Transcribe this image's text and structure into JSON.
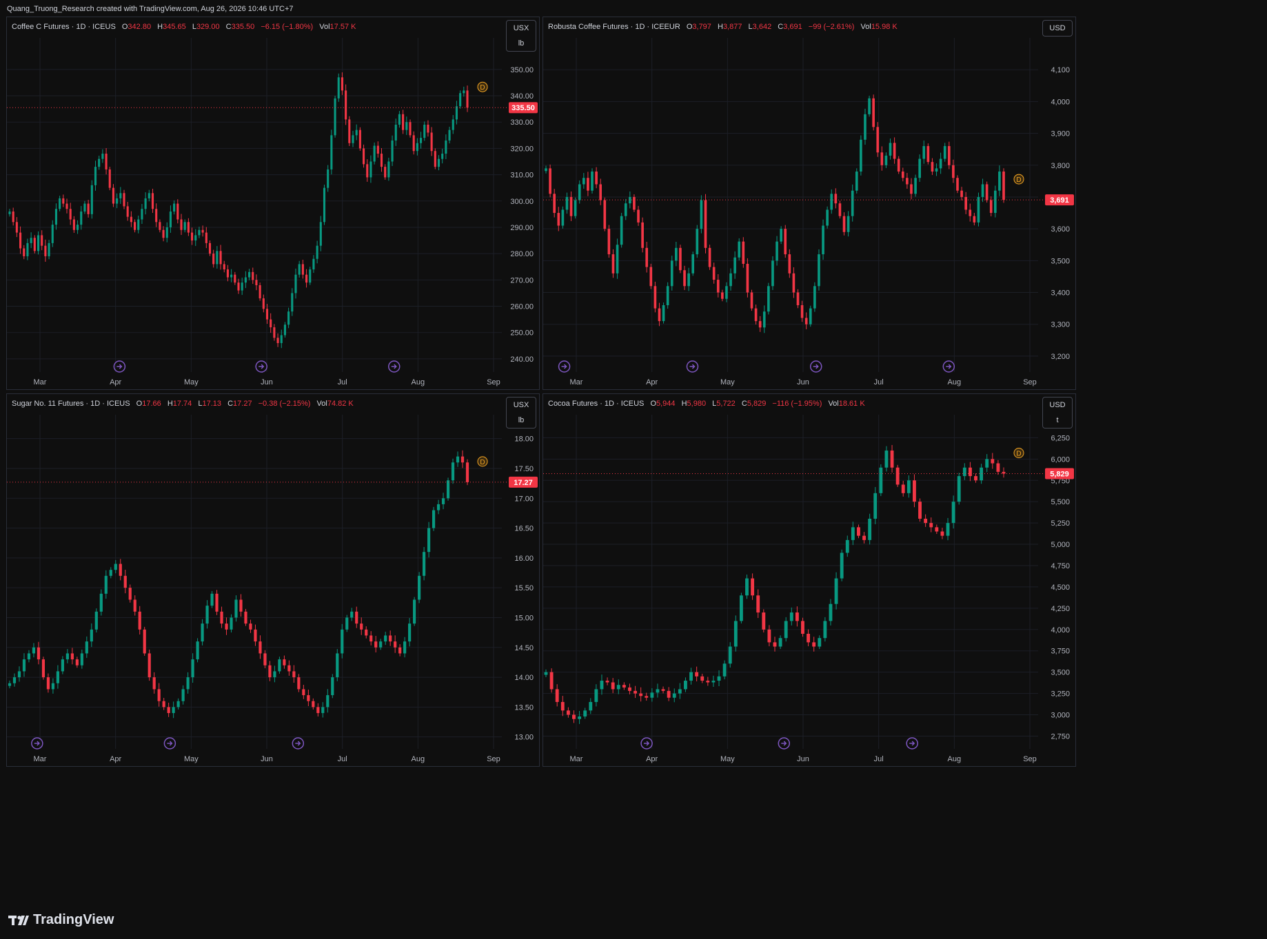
{
  "header": {
    "text": "Quang_Truong_Research created with TradingView.com, Aug 26, 2026 10:46 UTC+7"
  },
  "footer": {
    "brand": "TradingView"
  },
  "colors": {
    "up": "#089981",
    "down": "#f23645",
    "grid": "#1c1f27",
    "text": "#b2b5be",
    "marker": "#f5a623",
    "event": "#7e57c2"
  },
  "chart_data": [
    {
      "type": "candlestick",
      "legend": {
        "symbol": "Coffee C Futures · 1D · ICEUS",
        "open": "342.80",
        "high": "345.65",
        "low": "329.00",
        "close": "335.50",
        "change": "−6.15 (−1.80%)",
        "volume": "17.57 K"
      },
      "units": [
        "USX",
        "lb"
      ],
      "y_ticks": [
        "350.00",
        "340.00",
        "330.00",
        "320.00",
        "310.00",
        "300.00",
        "290.00",
        "280.00",
        "270.00",
        "260.00",
        "250.00",
        "240.00"
      ],
      "y_tick_values": [
        350,
        340,
        330,
        320,
        310,
        300,
        290,
        280,
        270,
        260,
        250,
        240
      ],
      "ylim": [
        235,
        362
      ],
      "x_ticks": [
        "Mar",
        "Apr",
        "May",
        "Jun",
        "Jul",
        "Aug",
        "Sep"
      ],
      "last_price": "335.50",
      "last_value": 335.5,
      "series": [
        296,
        292,
        288,
        282,
        279,
        284,
        286,
        281,
        287,
        283,
        279,
        284,
        291,
        297,
        301,
        299,
        297,
        293,
        289,
        291,
        296,
        299,
        295,
        306,
        313,
        316,
        318,
        312,
        305,
        299,
        301,
        303,
        298,
        294,
        292,
        289,
        293,
        297,
        301,
        303,
        297,
        292,
        289,
        286,
        290,
        296,
        299,
        293,
        289,
        292,
        288,
        285,
        287,
        289,
        288,
        284,
        280,
        276,
        281,
        276,
        274,
        271,
        272,
        269,
        266,
        269,
        271,
        273,
        270,
        268,
        263,
        259,
        255,
        252,
        248,
        246,
        249,
        253,
        258,
        265,
        272,
        276,
        272,
        269,
        274,
        278,
        283,
        292,
        305,
        312,
        325,
        339,
        347,
        342,
        331,
        322,
        325,
        327,
        320,
        314,
        309,
        315,
        321,
        318,
        313,
        309,
        315,
        323,
        329,
        333,
        327,
        330,
        325,
        319,
        322,
        324,
        329,
        326,
        319,
        313,
        316,
        318,
        323,
        327,
        331,
        336,
        341,
        342,
        335.5
      ],
      "event_positions": [
        0.24,
        0.55,
        0.84
      ]
    },
    {
      "type": "candlestick",
      "legend": {
        "symbol": "Robusta Coffee Futures · 1D · ICEEUR",
        "open": "3,797",
        "high": "3,877",
        "low": "3,642",
        "close": "3,691",
        "change": "−99 (−2.61%)",
        "volume": "15.98 K"
      },
      "units": [
        "USD"
      ],
      "y_ticks": [
        "4,100",
        "4,000",
        "3,900",
        "3,800",
        "3,700",
        "3,600",
        "3,500",
        "3,400",
        "3,300",
        "3,200"
      ],
      "y_tick_values": [
        4100,
        4000,
        3900,
        3800,
        3700,
        3600,
        3500,
        3400,
        3300,
        3200
      ],
      "ylim": [
        3150,
        4200
      ],
      "x_ticks": [
        "Mar",
        "Apr",
        "May",
        "Jun",
        "Jul",
        "Aug",
        "Sep"
      ],
      "last_price": "3,691",
      "last_value": 3691,
      "series": [
        3790,
        3710,
        3650,
        3610,
        3660,
        3700,
        3640,
        3690,
        3740,
        3760,
        3720,
        3780,
        3740,
        3690,
        3600,
        3520,
        3460,
        3550,
        3640,
        3680,
        3700,
        3660,
        3620,
        3540,
        3480,
        3420,
        3350,
        3310,
        3360,
        3420,
        3500,
        3540,
        3470,
        3420,
        3460,
        3520,
        3600,
        3690,
        3540,
        3480,
        3440,
        3400,
        3380,
        3420,
        3460,
        3510,
        3560,
        3490,
        3400,
        3350,
        3310,
        3290,
        3340,
        3420,
        3500,
        3560,
        3600,
        3520,
        3460,
        3400,
        3360,
        3320,
        3300,
        3350,
        3420,
        3520,
        3610,
        3660,
        3710,
        3680,
        3640,
        3590,
        3640,
        3720,
        3780,
        3880,
        3960,
        4010,
        3920,
        3840,
        3800,
        3830,
        3870,
        3820,
        3780,
        3760,
        3740,
        3710,
        3760,
        3820,
        3860,
        3810,
        3780,
        3790,
        3820,
        3860,
        3800,
        3760,
        3720,
        3700,
        3660,
        3640,
        3620,
        3700,
        3740,
        3690,
        3650,
        3720,
        3780,
        3691
      ],
      "event_positions": [
        0.04,
        0.32,
        0.59,
        0.88
      ]
    },
    {
      "type": "candlestick",
      "legend": {
        "symbol": "Sugar No. 11 Futures · 1D · ICEUS",
        "open": "17.66",
        "high": "17.74",
        "low": "17.13",
        "close": "17.27",
        "change": "−0.38 (−2.15%)",
        "volume": "74.82 K"
      },
      "units": [
        "USX",
        "lb"
      ],
      "y_ticks": [
        "18.00",
        "17.50",
        "17.00",
        "16.50",
        "16.00",
        "15.50",
        "15.00",
        "14.50",
        "14.00",
        "13.50",
        "13.00"
      ],
      "y_tick_values": [
        18,
        17.5,
        17,
        16.5,
        16,
        15.5,
        15,
        14.5,
        14,
        13.5,
        13
      ],
      "ylim": [
        12.8,
        18.4
      ],
      "x_ticks": [
        "Mar",
        "Apr",
        "May",
        "Jun",
        "Jul",
        "Aug",
        "Sep"
      ],
      "last_price": "17.27",
      "last_value": 17.27,
      "series": [
        13.9,
        14.0,
        14.1,
        14.3,
        14.4,
        14.5,
        14.3,
        14.0,
        13.8,
        13.9,
        14.1,
        14.3,
        14.4,
        14.3,
        14.2,
        14.4,
        14.6,
        14.8,
        15.1,
        15.4,
        15.7,
        15.8,
        15.9,
        15.7,
        15.5,
        15.3,
        15.1,
        14.8,
        14.4,
        14.0,
        13.8,
        13.6,
        13.5,
        13.4,
        13.5,
        13.6,
        13.8,
        14.0,
        14.3,
        14.6,
        14.9,
        15.2,
        15.4,
        15.1,
        14.9,
        14.8,
        15.0,
        15.3,
        15.1,
        14.9,
        14.8,
        14.6,
        14.4,
        14.2,
        14.0,
        14.1,
        14.3,
        14.2,
        14.1,
        14.0,
        13.8,
        13.7,
        13.6,
        13.5,
        13.4,
        13.5,
        13.7,
        14.0,
        14.4,
        14.8,
        15.0,
        15.1,
        14.9,
        14.8,
        14.7,
        14.6,
        14.5,
        14.6,
        14.7,
        14.6,
        14.5,
        14.4,
        14.6,
        14.9,
        15.3,
        15.7,
        16.1,
        16.5,
        16.8,
        16.9,
        17.0,
        17.3,
        17.6,
        17.7,
        17.6,
        17.27
      ],
      "event_positions": [
        0.06,
        0.35,
        0.63
      ]
    },
    {
      "type": "candlestick",
      "legend": {
        "symbol": "Cocoa Futures · 1D · ICEUS",
        "open": "5,944",
        "high": "5,980",
        "low": "5,722",
        "close": "5,829",
        "change": "−116 (−1.95%)",
        "volume": "18.61 K"
      },
      "units": [
        "USD",
        "t"
      ],
      "y_ticks": [
        "6,250",
        "6,000",
        "5,750",
        "5,500",
        "5,250",
        "5,000",
        "4,750",
        "4,500",
        "4,250",
        "4,000",
        "3,750",
        "3,500",
        "3,250",
        "3,000",
        "2,750"
      ],
      "y_tick_values": [
        6250,
        6000,
        5750,
        5500,
        5250,
        5000,
        4750,
        4500,
        4250,
        4000,
        3750,
        3500,
        3250,
        3000,
        2750
      ],
      "ylim": [
        2600,
        6520
      ],
      "x_ticks": [
        "Mar",
        "Apr",
        "May",
        "Jun",
        "Jul",
        "Aug",
        "Sep"
      ],
      "last_price": "5,829",
      "last_value": 5829,
      "series": [
        3500,
        3300,
        3150,
        3050,
        3000,
        2950,
        2980,
        3050,
        3150,
        3300,
        3400,
        3380,
        3300,
        3350,
        3320,
        3280,
        3250,
        3220,
        3200,
        3260,
        3300,
        3280,
        3200,
        3250,
        3300,
        3400,
        3500,
        3450,
        3400,
        3380,
        3400,
        3450,
        3600,
        3800,
        4100,
        4400,
        4600,
        4400,
        4200,
        4000,
        3850,
        3800,
        3900,
        4100,
        4200,
        4100,
        3950,
        3850,
        3800,
        3900,
        4100,
        4300,
        4600,
        4900,
        5050,
        5200,
        5100,
        5050,
        5300,
        5600,
        5900,
        6100,
        5900,
        5700,
        5600,
        5750,
        5500,
        5300,
        5250,
        5200,
        5150,
        5100,
        5250,
        5500,
        5800,
        5900,
        5800,
        5750,
        5900,
        6000,
        5950,
        5850,
        5829
      ],
      "event_positions": [
        0.22,
        0.52,
        0.8
      ]
    }
  ]
}
